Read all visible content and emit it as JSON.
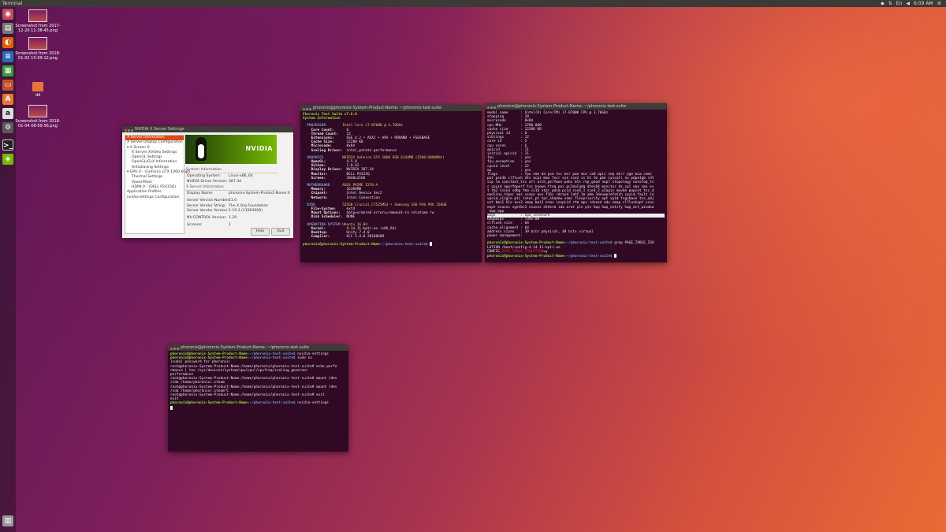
{
  "topbar": {
    "title": "Terminal",
    "clock": "6:09 AM"
  },
  "desktop": {
    "icons": [
      {
        "label": "Screenshot from 2017-12-20 11-38-45.png"
      },
      {
        "label": "Screenshot from 2018-01-02 15-09-12.png"
      },
      {
        "label": "dd"
      },
      {
        "label": "Screenshot from 2018-01-04 08-09-56.png"
      }
    ]
  },
  "nvidia": {
    "title": "NVIDIA X Server Settings",
    "tree": [
      "X Server Information",
      "X Server Display Configuration",
      "▾ X Screen 0",
      "X Server XVideo Settings",
      "OpenGL Settings",
      "OpenGL/GLX Information",
      "Antialiasing Settings",
      "▾ GPU 0 - (GeForce GTX 1060 6GB)",
      "Thermal Settings",
      "PowerMizer",
      "HDMI-0 - (DELL P2415Q)",
      "Application Profiles",
      "nvidia-settings Configuration"
    ],
    "logo": "NVIDIA",
    "section1": "System Information",
    "os_label": "Operating System:",
    "os_value": "Linux-x86_64",
    "driver_label": "NVIDIA Driver Version:",
    "driver_value": "387.34",
    "section2": "X Server Information",
    "display_label": "Display Name:",
    "display_value": "phoronix-System-Product-Name:0",
    "svn_label": "Server Version Number:",
    "svn_value": "11.0",
    "vendor_label": "Server Vendor String:",
    "vendor_value": "The X.Org Foundation",
    "vver_label": "Server Vendor Version:",
    "vver_value": "1.19.3 (11903000)",
    "nvctrl_label": "NV-CONTROL Version:",
    "nvctrl_value": "1.29",
    "screens_label": "Screens:",
    "screens_value": "1",
    "help": "Help",
    "quit": "Quit"
  },
  "term1": {
    "title": "phoronix@phoronix-System-Product-Name: ~/phoronix-test-suite",
    "header1": "Phoronix Test Suite v7.6.0",
    "header2": "System Information",
    "sections": [
      {
        "name": "PROCESSOR",
        "first": "Intel Core i7-8700K @ 4.70GHz",
        "rows": [
          [
            "Core Count:",
            "6"
          ],
          [
            "Thread Count:",
            "12"
          ],
          [
            "Extensions:",
            "SSE 4.2 + AVX2 + AVX + RDRAND + FSGSBASE"
          ],
          [
            "Cache Size:",
            "12288 KB"
          ],
          [
            "Microcode:",
            "0x84"
          ],
          [
            "Scaling Driver:",
            "intel_pstate performance"
          ]
        ]
      },
      {
        "name": "GRAPHICS",
        "first": "NVIDIA GeForce GTX 1060 6GB 6144MB (1506/4006MHz)",
        "rows": [
          [
            "OpenGL:",
            "4.5.0"
          ],
          [
            "Vulkan:",
            "1.0.42"
          ],
          [
            "Display Driver:",
            "NVIDIA 387.34"
          ],
          [
            "Monitor:",
            "DELL P2415Q"
          ],
          [
            "Screen:",
            "3840x2160"
          ]
        ]
      },
      {
        "name": "MOTHERBOARD",
        "first": "ASUS PRIME Z370-A",
        "rows": [
          [
            "Memory:",
            "16384MB"
          ],
          [
            "Chipset:",
            "Intel Device 3ec2"
          ],
          [
            "Network:",
            "Intel Connection"
          ]
        ]
      },
      {
        "name": "DISK",
        "first": "525GB Crucial_CT525MX3 + Samsung SSD 950 PRO 256GB",
        "rows": [
          [
            "File-System:",
            "ext4"
          ],
          [
            "Mount Options:",
            "data=ordered errors=remount-ro relatime rw"
          ],
          [
            "Disk Scheduler:",
            "NONE"
          ]
        ]
      },
      {
        "name": "OPERATING SYSTEM",
        "first": "Ubuntu 16.04",
        "rows": [
          [
            "Kernel:",
            "4.14.11-kpti-on (x86_64)"
          ],
          [
            "Desktop:",
            "Unity 7.4.0"
          ],
          [
            "Compiler:",
            "GCC 5.4.0 20160609"
          ]
        ]
      }
    ],
    "prompt_user": "phoronix@phoronix-System-Product-Name",
    "prompt_path": ":~/phoronix-test-suite$"
  },
  "term2": {
    "title": "phoronix@phoronix-System-Product-Name: ~/phoronix-test-suite",
    "lines": [
      "model name      : Intel(R) Core(TM) i7-8700K CPU @ 3.70GHz",
      "stepping        : 10",
      "microcode       : 0x84",
      "cpu MHz         : 3700.000",
      "cache size      : 12288 KB",
      "physical id     : 0",
      "siblings        : 12",
      "core id         : 5",
      "cpu cores       : 6",
      "apicid          : 11",
      "initial apicid  : 11",
      "fpu             : yes",
      "fpu_exception   : yes",
      "cpuid level     : 22",
      "wp              : yes",
      "flags           : fpu vme de pse tsc msr pae mce cx8 apic sep mtrr pge mca cmov",
      "pat pse36 clflush dts acpi mmx fxsr sse sse2 ss ht tm pbe syscall nx pdpe1gb rdt",
      "scp lm constant_tsc art arch_perfmon pebs bts rep_good nopl xtopology nonstop_ts",
      "c cpuid aperfmperf tsc_known_freq pni pclmulqdq dtes64 monitor ds_cpl vmx smx es",
      "t tm2 ssse3 sdbg fma cx16 xtpr pdcm pcid sse4_1 sse4_2 x2apic movbe popcnt tsc_d",
      "eadline_timer aes xsave avx f16c rdrand lahf_lm abm 3dnowprefetch cpuid_fault in",
      "vpcid_single pti intel_pt tpr_shadow vnmi flexpriority ept vpid fsgsbase tsc_adj",
      "ust bmi1 hle avx2 smep bmi2 erms invpcid rtm mpx rdseed adx smap clflushopt xsav",
      "eopt xsavec xgetbv1 xsaves dtherm ida arat pln pts hwp hwp_notify hwp_act_window",
      " hwp_epp"
    ],
    "bugs_label": "bugs            :",
    "bugs_value": " cpu_insecure",
    "tail": [
      "bogomips        : 7392.00",
      "clflush size    : 64",
      "cache_alignment : 64",
      "address sizes   : 39 bits physical, 48 bits virtual",
      "power management:"
    ],
    "cmd": " grep PAGE_TABLE_ISO",
    "cmd2": "LATION /boot/config-4.14.11-kpti-on",
    "config_prefix": "CONFIG_",
    "config_match": "PAGE_TABLE_ISOLATION",
    "config_suffix": "=y",
    "prompt_user": "phoronix@phoronix-System-Product-Name",
    "prompt_path": ":~/phoronix-test-suite$"
  },
  "term3": {
    "title": "phoronix@phoronix-System-Product-Name: ~/phoronix-test-suite",
    "prompt_user": "phoronix@phoronix-System-Product-Name",
    "prompt_path": ":~/phoronix-test-suite$",
    "cmd1": " nvidia-settings",
    "cmd2": " sudo su",
    "l3": "[sudo] password for phoronix:",
    "l4": "root@phoronix-System-Product-Name:/home/phoronix/phoronix-test-suite# echo perfo",
    "l5": "rmance | tee /sys/devices/system/cpu/cpu*/cpufreq/scaling_governor",
    "l6": "performance",
    "l7": "root@phoronix-System-Product-Name:/home/phoronix/phoronix-test-suite# mount /dev",
    "l8": "/sda /home/phoronix/.steam",
    "l9": "root@phoronix-System-Product-Name:/home/phoronix/phoronix-test-suite# mount /dev",
    "l10": "/sda /home/phoronix/.steam^C",
    "l11": "root@phoronix-System-Product-Name:/home/phoronix/phoronix-test-suite# exit",
    "l12": "exit",
    "cmd3": " nvidia-settings"
  }
}
